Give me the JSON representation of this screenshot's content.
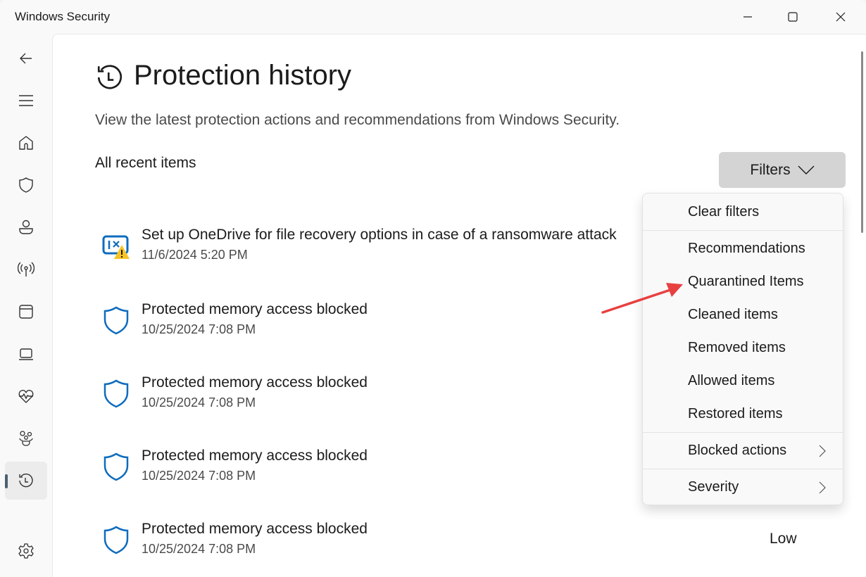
{
  "window": {
    "title": "Windows Security",
    "controls": {
      "minimize": "minimize-icon",
      "maximize": "maximize-icon",
      "close": "close-icon"
    }
  },
  "sidebar": {
    "items": [
      {
        "id": "back",
        "icon": "back-arrow-icon"
      },
      {
        "id": "menu",
        "icon": "hamburger-menu-icon"
      },
      {
        "id": "home",
        "icon": "home-icon"
      },
      {
        "id": "virus-protection",
        "icon": "shield-icon"
      },
      {
        "id": "account-protection",
        "icon": "person-icon"
      },
      {
        "id": "firewall-network",
        "icon": "antenna-icon"
      },
      {
        "id": "app-browser-control",
        "icon": "app-window-icon"
      },
      {
        "id": "device-security",
        "icon": "laptop-icon"
      },
      {
        "id": "device-health",
        "icon": "heart-pulse-icon"
      },
      {
        "id": "family-options",
        "icon": "family-icon"
      },
      {
        "id": "protection-history",
        "icon": "history-icon",
        "active": true
      },
      {
        "id": "settings",
        "icon": "gear-icon"
      }
    ]
  },
  "main": {
    "title": "Protection history",
    "description": "View the latest protection actions and recommendations from Windows Security.",
    "section_label": "All recent items",
    "filters_label": "Filters",
    "items": [
      {
        "icon": "onedrive-warning-icon",
        "title": "Set up OneDrive for file recovery options in case of a ransomware attack",
        "date": "11/6/2024 5:20 PM"
      },
      {
        "icon": "shield-icon",
        "title": "Protected memory access blocked",
        "date": "10/25/2024 7:08 PM"
      },
      {
        "icon": "shield-icon",
        "title": "Protected memory access blocked",
        "date": "10/25/2024 7:08 PM"
      },
      {
        "icon": "shield-icon",
        "title": "Protected memory access blocked",
        "date": "10/25/2024 7:08 PM"
      },
      {
        "icon": "shield-icon",
        "title": "Protected memory access blocked",
        "date": "10/25/2024 7:08 PM",
        "severity": "Low"
      }
    ]
  },
  "filters_menu": {
    "clear": "Clear filters",
    "types": [
      "Recommendations",
      "Quarantined Items",
      "Cleaned items",
      "Removed items",
      "Allowed items",
      "Restored items"
    ],
    "blocked_actions": "Blocked actions",
    "severity": "Severity"
  },
  "colors": {
    "accent_blue": "#0f6cbd",
    "warning_yellow": "#f7c325",
    "annotation_red": "#e84040"
  }
}
